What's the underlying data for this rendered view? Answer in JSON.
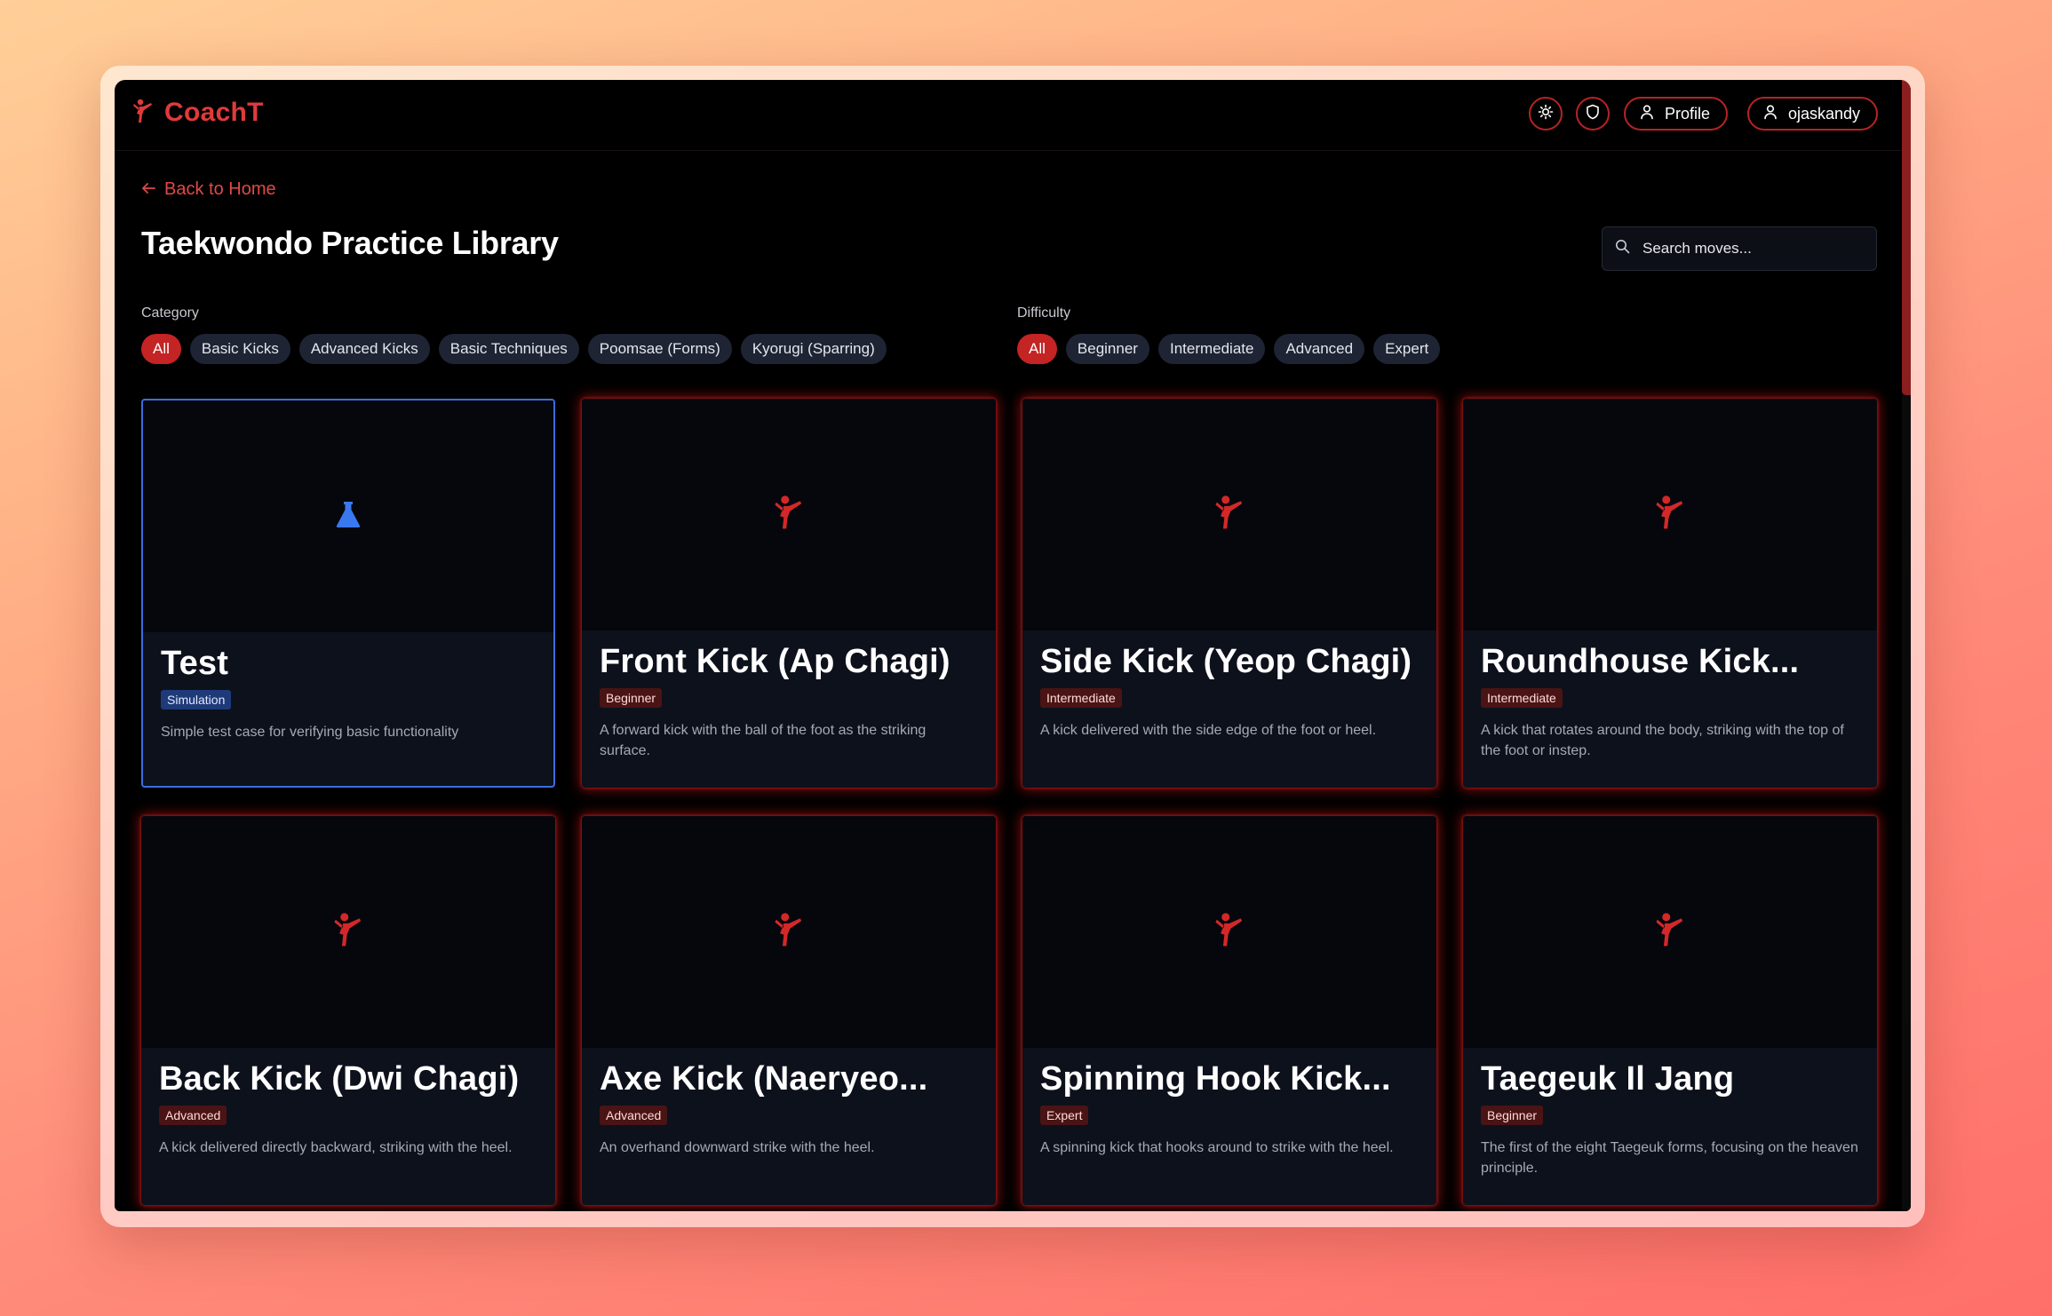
{
  "app": {
    "brand": "CoachT",
    "colors": {
      "accent": "#c42424",
      "brand_text": "#e03a3a",
      "simulation_blue": "#3a6ee0",
      "background": "#000000",
      "card": "#0d111c"
    }
  },
  "header": {
    "theme_toggle_icon": "sun-icon",
    "shield_icon": "shield-icon",
    "profile_label": "Profile",
    "username": "ojaskandy"
  },
  "nav": {
    "back_label": "Back to Home"
  },
  "page": {
    "title": "Taekwondo Practice Library"
  },
  "search": {
    "placeholder": "Search moves..."
  },
  "filters": {
    "category": {
      "label": "Category",
      "options": [
        "All",
        "Basic Kicks",
        "Advanced Kicks",
        "Basic Techniques",
        "Poomsae (Forms)",
        "Kyorugi (Sparring)"
      ],
      "selected": "All"
    },
    "difficulty": {
      "label": "Difficulty",
      "options": [
        "All",
        "Beginner",
        "Intermediate",
        "Advanced",
        "Expert"
      ],
      "selected": "All"
    }
  },
  "cards": [
    {
      "title": "Test",
      "badge": "Simulation",
      "description": "Simple test case for verifying basic functionality",
      "icon": "flask-icon"
    },
    {
      "title": "Front Kick (Ap Chagi)",
      "badge": "Beginner",
      "description": "A forward kick with the ball of the foot as the striking surface.",
      "icon": "kicking-figure-icon"
    },
    {
      "title": "Side Kick (Yeop Chagi)",
      "badge": "Intermediate",
      "description": "A kick delivered with the side edge of the foot or heel.",
      "icon": "kicking-figure-icon"
    },
    {
      "title": "Roundhouse Kick...",
      "badge": "Intermediate",
      "description": "A kick that rotates around the body, striking with the top of the foot or instep.",
      "icon": "kicking-figure-icon"
    },
    {
      "title": "Back Kick (Dwi Chagi)",
      "badge": "Advanced",
      "description": "A kick delivered directly backward, striking with the heel.",
      "icon": "kicking-figure-icon"
    },
    {
      "title": "Axe Kick (Naeryeo...",
      "badge": "Advanced",
      "description": "An overhand downward strike with the heel.",
      "icon": "kicking-figure-icon"
    },
    {
      "title": "Spinning Hook Kick...",
      "badge": "Expert",
      "description": "A spinning kick that hooks around to strike with the heel.",
      "icon": "kicking-figure-icon"
    },
    {
      "title": "Taegeuk Il Jang",
      "badge": "Beginner",
      "description": "The first of the eight Taegeuk forms, focusing on the heaven principle.",
      "icon": "kicking-figure-icon"
    }
  ]
}
